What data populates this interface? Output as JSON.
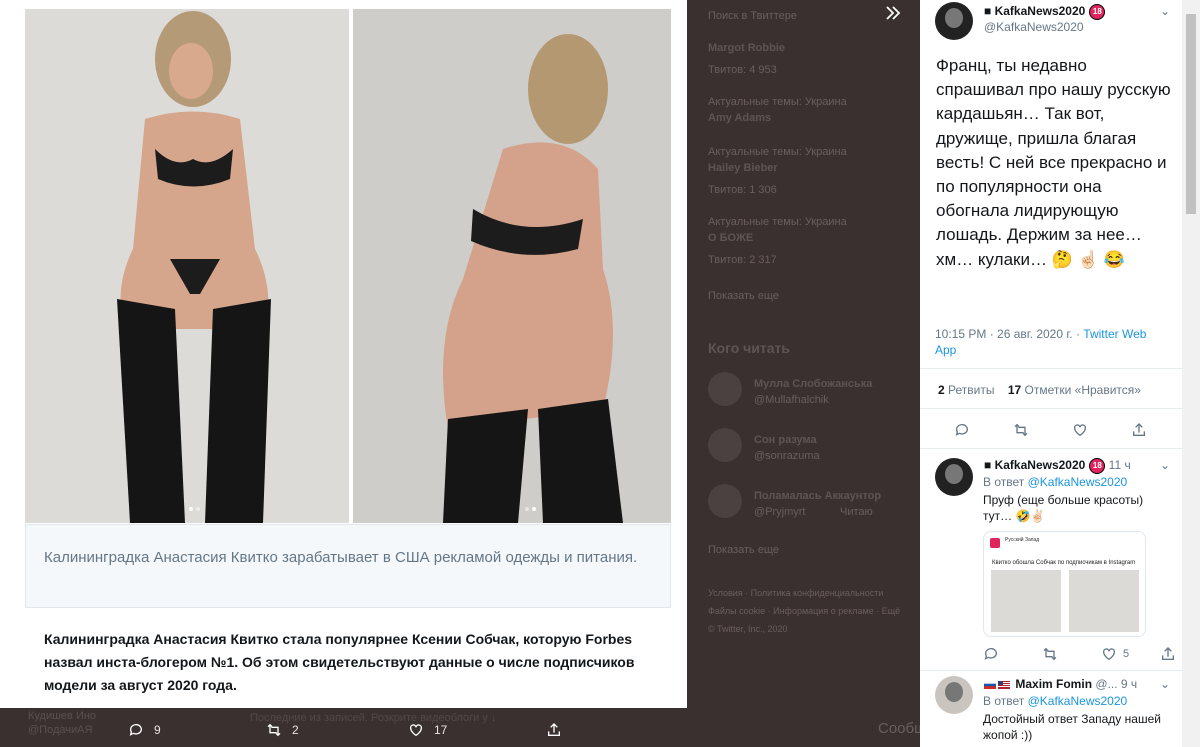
{
  "background": {
    "search_placeholder": "Поиск в Твиттере",
    "trends": [
      {
        "title": "Margot Robbie",
        "count": "Твитов: 4 953"
      },
      {
        "context": "Актуальные темы: Украина",
        "title": "Amy Adams"
      },
      {
        "context": "Актуальные темы: Украина",
        "title": "Hailey Bieber",
        "count": "Твитов: 1 306"
      },
      {
        "context": "Актуальные темы: Украина",
        "title": "О БОЖЕ",
        "count": "Твитов: 2 317"
      }
    ],
    "show_more": "Показать еще",
    "who_to_follow": "Кого читать",
    "follow_suggestions": [
      {
        "name": "Мулла Слобожанська",
        "handle": "@Mullafhalchik"
      },
      {
        "name": "Сон разума",
        "handle": "@sonrazuma"
      },
      {
        "name": "Поламалась Аккаунтор",
        "handle": "@Pryjmyrt",
        "action": "Читаю"
      }
    ],
    "show_more_2": "Показать еще",
    "footer_lines": [
      "Условия · Политика конфиденциальности",
      "Файлы cookie · Информация о рекламе · Ещё",
      "© Twitter, Inc., 2020"
    ],
    "bottom_faint": "Последние из записей. Розкрите видеоблоги у ↓",
    "bottom_faint2": "з нас, Кудикосбр(й) сз",
    "bottom_left_name": "Кудишев Ино",
    "bottom_left_handle": "@ПодачиАЯ",
    "messages_label": "Сообщения",
    "stats": {
      "replies": "9",
      "retweets": "2",
      "likes": "17"
    }
  },
  "media": {
    "caption": "Калининградка Анастасия Квитко зарабатывает в США рекламой одежды и питания.",
    "article": "Калининградка Анастасия Квитко стала популярнее Ксении Собчак, которую Forbes назвал инста-блогером №1. Об этом свидетельствуют данные о числе подписчиков модели за август 2020 года."
  },
  "tweet": {
    "name": "KafkaNews2020",
    "badge": "18",
    "handle": "@KafkaNews2020",
    "text": "Франц, ты недавно спрашивал про нашу русскую кардашьян… Так вот, дружище, пришла благая весть! С ней все прекрасно и по популярности она обогнала лидирующую лошадь. Держим за нее… хм… кулаки… 🤔 ☝🏻 😂",
    "time": "10:15 PM · 26 авг. 2020 г.",
    "source": "Twitter Web App",
    "retweets_count": "2",
    "retweets_label": "Ретвиты",
    "likes_count": "17",
    "likes_label": "Отметки «Нравится»"
  },
  "replies": [
    {
      "name": "KafkaNews2020",
      "badge": "18",
      "time": "11 ч",
      "reply_to_label": "В ответ",
      "reply_to": "@KafkaNews2020",
      "text": "Пруф (еще больше красоты)  тут… 🤣✌🏻",
      "embed_source": "Русский Запад",
      "embed_title": "Квитко обошла Собчак по подписчикам в Instagram",
      "likes": "5"
    },
    {
      "name": "Maxim Fomin",
      "handle": "@...",
      "time": "9 ч",
      "reply_to_label": "В ответ",
      "reply_to": "@KafkaNews2020",
      "text": "Достойный ответ Западу нашей жопой :))"
    }
  ],
  "colors": {
    "link": "#1b95e0",
    "badge": "#e0245e"
  }
}
